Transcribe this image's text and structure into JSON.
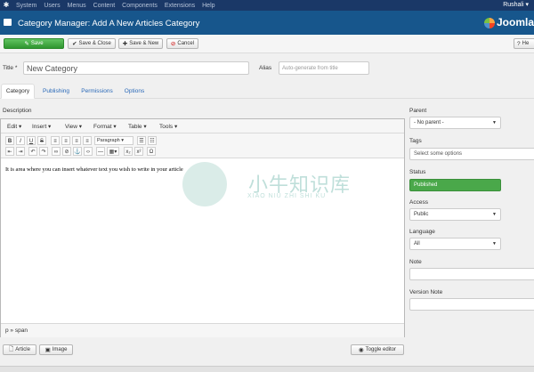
{
  "topmenu": {
    "items": [
      "System",
      "Users",
      "Menus",
      "Content",
      "Components",
      "Extensions",
      "Help"
    ],
    "user": "Rushali ▾"
  },
  "header": {
    "title": "Category Manager: Add A New Articles Category",
    "brand": "Joomla"
  },
  "toolbar": {
    "save": "Save",
    "save_close": "Save & Close",
    "save_new": "Save & New",
    "cancel": "Cancel",
    "help": "He"
  },
  "form": {
    "title_label": "Title *",
    "title_value": "New Category",
    "alias_label": "Alias",
    "alias_placeholder": "Auto-generate from title"
  },
  "tabs": [
    "Category",
    "Publishing",
    "Permissions",
    "Options"
  ],
  "editor": {
    "label": "Description",
    "menus": [
      "Edit ▾",
      "Insert ▾",
      "View ▾",
      "Format ▾",
      "Table ▾",
      "Tools ▾"
    ],
    "paragraph_select": "Paragraph",
    "content": "It is area where you can insert whatever text you wish to write in your article",
    "statusbar": "p » span",
    "article_button": "Article",
    "image_button": "Image",
    "toggle_button": "Toggle editor"
  },
  "sidebar": {
    "parent_label": "Parent",
    "parent_value": "- No parent -",
    "tags_label": "Tags",
    "tags_placeholder": "Select some options",
    "status_label": "Status",
    "status_value": "Published",
    "access_label": "Access",
    "access_value": "Public",
    "language_label": "Language",
    "language_value": "All",
    "note_label": "Note",
    "version_note_label": "Version Note"
  },
  "watermark": {
    "chinese": "小牛知识库",
    "pinyin": "XIAO NIU ZHI SHI KU"
  },
  "colors": {
    "topbar": "#1a3867",
    "titlebar": "#17568c",
    "save_green": "#3da13e",
    "published_green": "#4aa84a",
    "link_blue": "#2a69b8"
  }
}
